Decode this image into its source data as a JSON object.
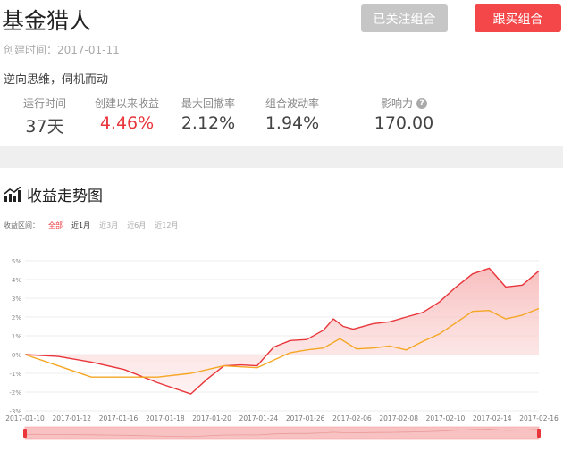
{
  "header": {
    "title": "基金猎人",
    "follow_label": "已关注组合",
    "buy_label": "跟买组合",
    "created": "创建时间：2017-01-11",
    "description": "逆向思维，伺机而动"
  },
  "stats": [
    {
      "label": "运行时间",
      "value": "37天"
    },
    {
      "label": "创建以来收益",
      "value": "4.46%"
    },
    {
      "label": "最大回撤率",
      "value": "2.12%"
    },
    {
      "label": "组合波动率",
      "value": "1.94%"
    },
    {
      "label": "影响力",
      "value": "170.00"
    }
  ],
  "section": {
    "title": "收益走势图"
  },
  "period": {
    "label": "收益区间：",
    "options": [
      "全部",
      "近1月",
      "近3月",
      "近6月",
      "近12月"
    ],
    "selected": "全部"
  },
  "colors": {
    "accent": "#f3474a",
    "series_red": "#e8363b",
    "series_orange": "#f5a623",
    "follow_btn": "#c6c6c6"
  },
  "icons": {
    "section": "bar-chart-icon",
    "influence_help": "question-circle-icon"
  },
  "chart_data": {
    "type": "area",
    "x_labels": [
      "2017-01-10",
      "2017-01-12",
      "2017-01-16",
      "2017-01-18",
      "2017-01-20",
      "2017-01-24",
      "2017-01-26",
      "2017-02-06",
      "2017-02-08",
      "2017-02-10",
      "2017-02-14",
      "2017-02-16"
    ],
    "yticks": [
      "5%",
      "4%",
      "3%",
      "2%",
      "1%",
      "0%",
      "-1%",
      "-2%",
      "-3%"
    ],
    "ylim": [
      -3,
      5
    ],
    "grid": true,
    "series": [
      {
        "values": [
          [
            0,
            0
          ],
          [
            1,
            -0.1
          ],
          [
            2,
            -0.4
          ],
          [
            3,
            -0.8
          ],
          [
            4,
            -1.5
          ],
          [
            5,
            -2.1
          ],
          [
            5.5,
            -1.3
          ],
          [
            6,
            -0.6
          ],
          [
            6.5,
            -0.55
          ],
          [
            7,
            -0.6
          ],
          [
            7.5,
            0.4
          ],
          [
            8,
            0.75
          ],
          [
            8.5,
            0.8
          ],
          [
            9,
            1.3
          ],
          [
            9.3,
            1.9
          ],
          [
            9.6,
            1.5
          ],
          [
            9.9,
            1.35
          ],
          [
            10.5,
            1.65
          ],
          [
            11,
            1.75
          ],
          [
            11.5,
            2.0
          ],
          [
            12,
            2.25
          ],
          [
            12.5,
            2.8
          ],
          [
            13,
            3.6
          ],
          [
            13.5,
            4.3
          ],
          [
            14,
            4.6
          ],
          [
            14.5,
            3.6
          ],
          [
            15,
            3.7
          ],
          [
            15.5,
            4.46
          ]
        ],
        "color": "#e8363b"
      },
      {
        "values": [
          [
            0,
            0
          ],
          [
            1,
            -0.6
          ],
          [
            2,
            -1.2
          ],
          [
            3,
            -1.2
          ],
          [
            4,
            -1.2
          ],
          [
            5,
            -1.0
          ],
          [
            6,
            -0.6
          ],
          [
            7,
            -0.7
          ],
          [
            7.5,
            -0.3
          ],
          [
            8,
            0.1
          ],
          [
            8.5,
            0.25
          ],
          [
            9,
            0.35
          ],
          [
            9.5,
            0.85
          ],
          [
            10,
            0.3
          ],
          [
            10.5,
            0.35
          ],
          [
            11,
            0.45
          ],
          [
            11.5,
            0.25
          ],
          [
            12,
            0.7
          ],
          [
            12.5,
            1.1
          ],
          [
            13,
            1.7
          ],
          [
            13.5,
            2.3
          ],
          [
            14,
            2.35
          ],
          [
            14.5,
            1.9
          ],
          [
            15,
            2.1
          ],
          [
            15.5,
            2.45
          ]
        ],
        "color": "#f5a623"
      }
    ]
  }
}
